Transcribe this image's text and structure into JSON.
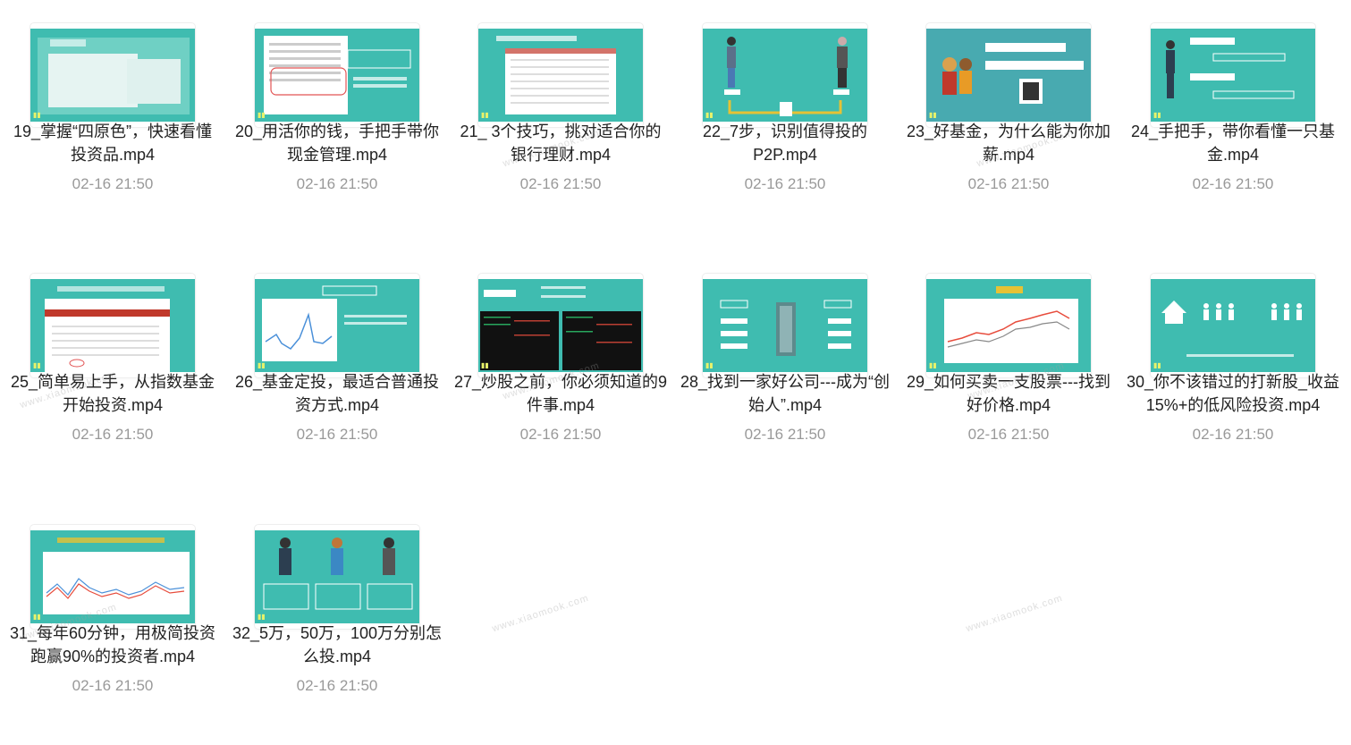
{
  "files": [
    {
      "name": "19_掌握“四原色”，快速看懂投资品.mp4",
      "date": "02-16 21:50",
      "thumb": "doc-panel"
    },
    {
      "name": "20_用活你的钱，手把手带你现金管理.mp4",
      "date": "02-16 21:50",
      "thumb": "doc-callout"
    },
    {
      "name": "21_ 3个技巧，挑对适合你的银行理财.mp4",
      "date": "02-16 21:50",
      "thumb": "table-sheet"
    },
    {
      "name": "22_7步，识别值得投的P2P.mp4",
      "date": "02-16 21:50",
      "thumb": "two-people"
    },
    {
      "name": "23_好基金，为什么能为你加薪.mp4",
      "date": "02-16 21:50",
      "thumb": "family-qr"
    },
    {
      "name": "24_手把手，带你看懂一只基金.mp4",
      "date": "02-16 21:50",
      "thumb": "man-buttons"
    },
    {
      "name": "25_简单易上手，从指数基金开始投资.mp4",
      "date": "02-16 21:50",
      "thumb": "fund-table"
    },
    {
      "name": "26_基金定投，最适合普通投资方式.mp4",
      "date": "02-16 21:50",
      "thumb": "line-chart"
    },
    {
      "name": "27_炒股之前，你必须知道的9件事.mp4",
      "date": "02-16 21:50",
      "thumb": "stock-screen"
    },
    {
      "name": "28_找到一家好公司---成为“创始人”.mp4",
      "date": "02-16 21:50",
      "thumb": "building"
    },
    {
      "name": "29_如何买卖一支股票---找到好价格.mp4",
      "date": "02-16 21:50",
      "thumb": "candle-chart"
    },
    {
      "name": "30_你不该错过的打新股_收益15%+的低风险投资.mp4",
      "date": "02-16 21:50",
      "thumb": "people-icons"
    },
    {
      "name": "31_每年60分钟，用极简投资跑赢90%的投资者.mp4",
      "date": "02-16 21:50",
      "thumb": "multi-line"
    },
    {
      "name": "32_5万，50万，100万分别怎么投.mp4",
      "date": "02-16 21:50",
      "thumb": "three-people"
    }
  ],
  "watermark": "www.xiaomook.com",
  "colors": {
    "thumb_bg": "#3fbcb0",
    "text": "#222222",
    "date": "#999999"
  }
}
